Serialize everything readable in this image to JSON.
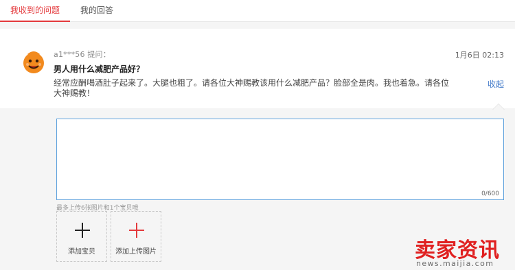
{
  "tabs": {
    "received": "我收到的问题",
    "answers": "我的回答"
  },
  "question": {
    "asker": "a1***56 提问：",
    "time": "1月6日 02:13",
    "title": "男人用什么减肥产品好？",
    "description": "经常应酬喝酒肚子起来了。大腿也粗了。请各位大神赐教该用什么减肥产品？脸部全是肉。我也着急。请各位大神赐教！",
    "collapse": "收起"
  },
  "answer": {
    "value": "",
    "counter": "0/600"
  },
  "hint": "最多上传6张图片和1个宝贝哦",
  "upload": {
    "goods_label": "添加宝贝",
    "image_label": "添加上传图片"
  },
  "watermark": {
    "text": "卖家资讯",
    "sub": "news.maijia.com"
  },
  "colors": {
    "accent": "#e4393c",
    "link": "#3f78c8",
    "focus_border": "#5fa2dd"
  }
}
